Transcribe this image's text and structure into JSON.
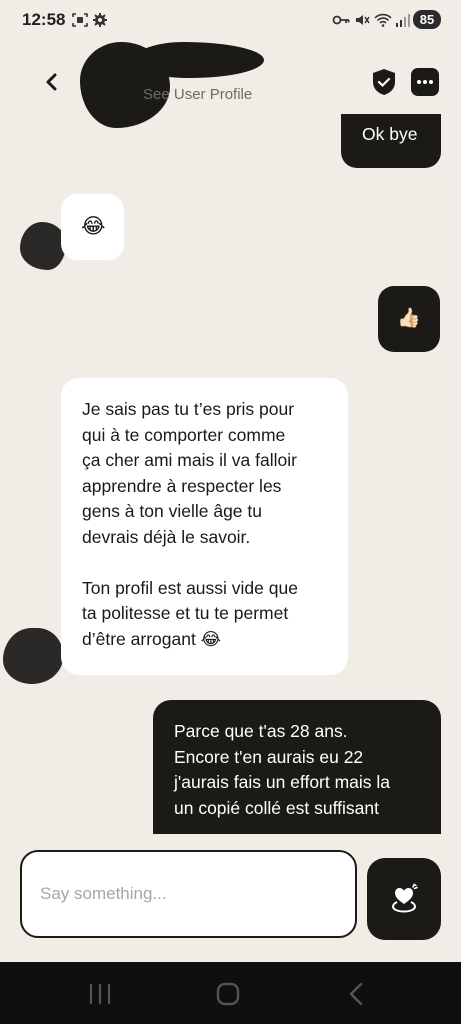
{
  "status_bar": {
    "time": "12:58",
    "battery": "85",
    "icons": [
      "screenshot-icon",
      "settings-icon",
      "vpn-key-icon",
      "mute-icon",
      "wifi-icon",
      "signal-icon"
    ]
  },
  "header": {
    "see_profile": "See User Profile",
    "icons": [
      "back-arrow-icon",
      "shield-check-icon",
      "more-dots-icon"
    ]
  },
  "messages": [
    {
      "direction": "out",
      "text": "Ok bye"
    },
    {
      "direction": "in",
      "text": "😂"
    },
    {
      "direction": "out",
      "text": "👍🏻"
    },
    {
      "direction": "in",
      "text": "Je sais pas tu t’es pris pour\nqui à te comporter comme\nça cher ami mais il va falloir\napprendre à respecter les\ngens à ton vielle âge tu\ndevrais déjà le savoir.\n\nTon profil est aussi vide que\nta politesse et tu te permet\nd’être arrogant 😂"
    },
    {
      "direction": "out",
      "text": "Parce que t'as 28 ans.\nEncore t'en aurais eu 22\nj'aurais fais un effort mais la\nun copié collé est suffisant"
    }
  ],
  "composer": {
    "placeholder": "Say something...",
    "send_icon": "heart-send-icon"
  },
  "nav_bar": {
    "icons": [
      "recents-icon",
      "home-icon",
      "back-icon"
    ]
  },
  "colors": {
    "background": "#f1ece5",
    "outgoing_bubble": "#1b1a17",
    "incoming_bubble": "#ffffff",
    "nav_bar": "#0f0f0f"
  }
}
